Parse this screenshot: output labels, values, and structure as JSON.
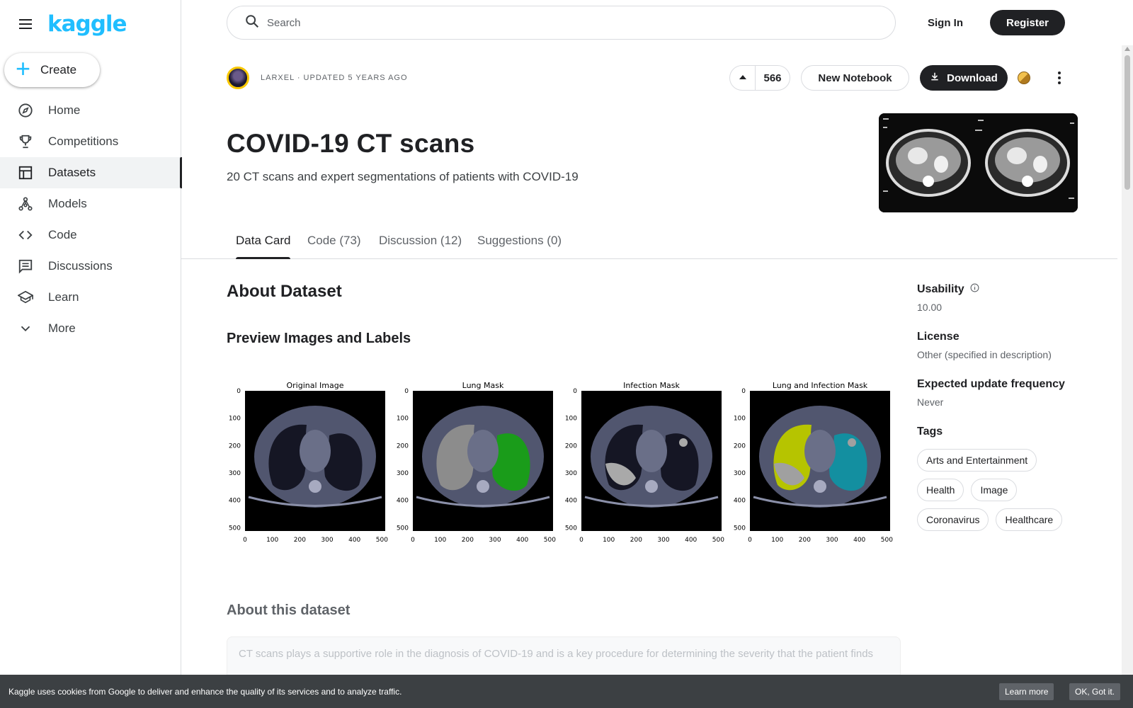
{
  "sidebar": {
    "logo": "kaggle",
    "create_label": "Create",
    "items": [
      {
        "label": "Home",
        "icon": "compass-icon"
      },
      {
        "label": "Competitions",
        "icon": "trophy-icon"
      },
      {
        "label": "Datasets",
        "icon": "table-icon"
      },
      {
        "label": "Models",
        "icon": "models-icon"
      },
      {
        "label": "Code",
        "icon": "code-icon"
      },
      {
        "label": "Discussions",
        "icon": "discussion-icon"
      },
      {
        "label": "Learn",
        "icon": "school-icon"
      },
      {
        "label": "More",
        "icon": "chevron-down-icon"
      }
    ],
    "active_item": "Datasets"
  },
  "header": {
    "search_placeholder": "Search",
    "signin_label": "Sign In",
    "register_label": "Register"
  },
  "dataset": {
    "owner_line": "LARXEL · UPDATED 5 YEARS AGO",
    "upvotes": "566",
    "new_notebook_label": "New Notebook",
    "download_label": "Download",
    "title": "COVID-19 CT scans",
    "subtitle": "20 CT scans and expert segmentations of patients with COVID-19"
  },
  "tabs": [
    {
      "label": "Data Card",
      "active": true
    },
    {
      "label": "Code (73)",
      "active": false
    },
    {
      "label": "Discussion (12)",
      "active": false
    },
    {
      "label": "Suggestions (0)",
      "active": false
    }
  ],
  "content": {
    "about_heading": "About Dataset",
    "preview_heading": "Preview Images and Labels",
    "figures": [
      {
        "title": "Original Image",
        "overlay": "none"
      },
      {
        "title": "Lung Mask",
        "overlay": "lung"
      },
      {
        "title": "Infection Mask",
        "overlay": "infection"
      },
      {
        "title": "Lung and Infection Mask",
        "overlay": "both"
      }
    ],
    "figure_ticks": [
      "0",
      "100",
      "200",
      "300",
      "400",
      "500"
    ],
    "about_this_heading": "About this dataset",
    "description_preview": "CT scans plays a supportive role in the diagnosis of COVID-19 and is a key procedure for determining the severity that the patient finds"
  },
  "meta": {
    "usability_label": "Usability",
    "usability_value": "10.00",
    "license_label": "License",
    "license_value": "Other (specified in description)",
    "frequency_label": "Expected update frequency",
    "frequency_value": "Never",
    "tags_label": "Tags",
    "tags": [
      "Arts and Entertainment",
      "Health",
      "Image",
      "Coronavirus",
      "Healthcare"
    ]
  },
  "cookie": {
    "text": "Kaggle uses cookies from Google to deliver and enhance the quality of its services and to analyze traffic.",
    "learn_more": "Learn more",
    "ok": "OK, Got it."
  },
  "colors": {
    "brand": "#20beff",
    "dark": "#202124",
    "lung_green": "#1a9c1a",
    "lung_yellow": "#b6c400",
    "infection_teal": "#138fa0"
  }
}
